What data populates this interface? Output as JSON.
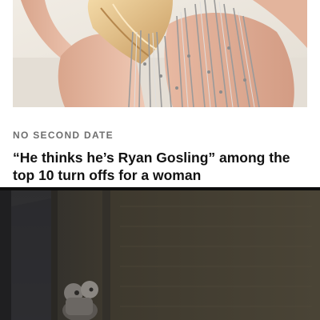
{
  "article": {
    "kicker": "NO SECOND DATE",
    "headline": "“He thinks he’s Ryan Gosling” among the top 10 turn offs for a woman"
  },
  "colors": {
    "kicker": "#6e6e6e",
    "headline": "#111111",
    "hero_background": "#ece7df",
    "video_background": "#39342a"
  },
  "icons": {
    "hero_image": "photo-two-women-sequin-tinsel",
    "video_frame": "dark-room-doorway-figure"
  }
}
